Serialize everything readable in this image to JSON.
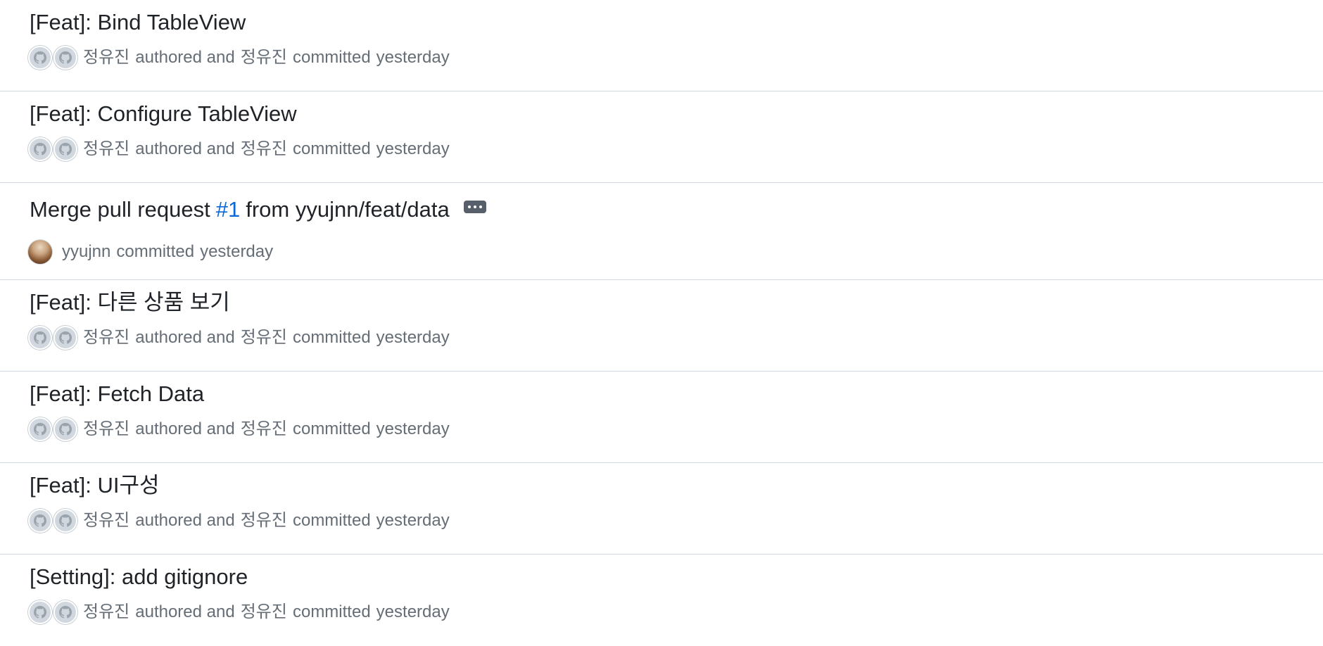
{
  "commits": [
    {
      "title": "[Feat]: Bind TableView",
      "author": "정유진",
      "authored_word": "authored and",
      "committer": "정유진",
      "committed_word": "committed",
      "when": "yesterday"
    },
    {
      "title": "[Feat]: Configure TableView",
      "author": "정유진",
      "authored_word": "authored and",
      "committer": "정유진",
      "committed_word": "committed",
      "when": "yesterday"
    },
    {
      "title_prefix": "Merge pull request",
      "issue": "#1",
      "title_suffix": "from yyujnn/feat/data",
      "committer": "yyujnn",
      "committed_word": "committed",
      "when": "yesterday"
    },
    {
      "title": "[Feat]: 다른 상품 보기",
      "author": "정유진",
      "authored_word": "authored and",
      "committer": "정유진",
      "committed_word": "committed",
      "when": "yesterday"
    },
    {
      "title": "[Feat]: Fetch Data",
      "author": "정유진",
      "authored_word": "authored and",
      "committer": "정유진",
      "committed_word": "committed",
      "when": "yesterday"
    },
    {
      "title": "[Feat]: UI구성",
      "author": "정유진",
      "authored_word": "authored and",
      "committer": "정유진",
      "committed_word": "committed",
      "when": "yesterday"
    },
    {
      "title": "[Setting]: add gitignore",
      "author": "정유진",
      "authored_word": "authored and",
      "committer": "정유진",
      "committed_word": "committed",
      "when": "yesterday"
    }
  ],
  "icons": {
    "default_avatar": "github-octocat-icon",
    "more_button": "ellipsis-icon"
  },
  "colors": {
    "link_blue": "#0969da",
    "muted_text": "#656d76",
    "divider": "#d0d7de"
  }
}
